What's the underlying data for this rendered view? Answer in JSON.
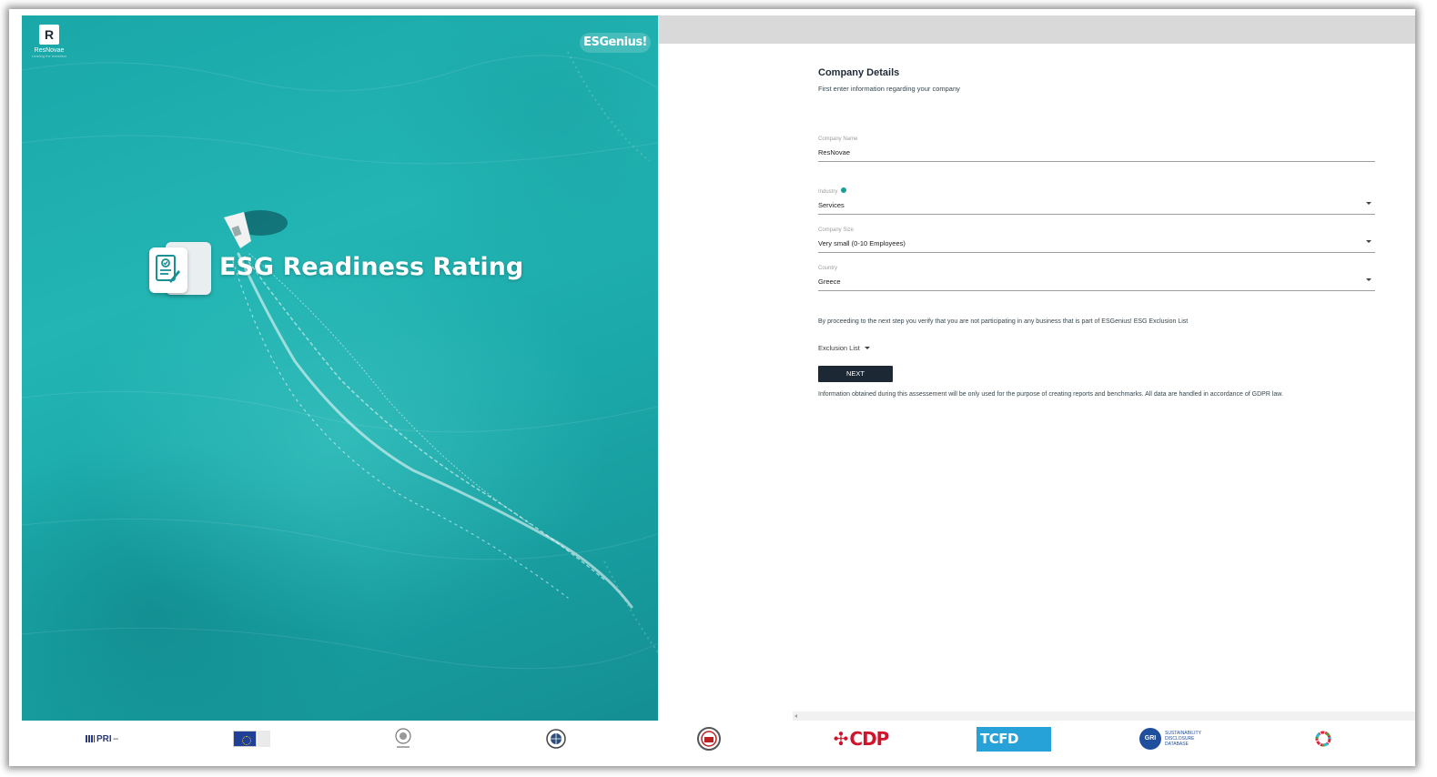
{
  "brand": {
    "left_logo_letter": "R",
    "left_logo_name": "ResNovae",
    "left_logo_tagline": "Leading the transition",
    "right_logo": "ESGenius!"
  },
  "hero": {
    "title": "ESG Readiness Rating"
  },
  "form": {
    "title": "Company Details",
    "subtitle": "First enter information regarding your company",
    "company_name": {
      "label": "Company Name",
      "value": "ResNovae"
    },
    "industry": {
      "label": "Industry",
      "value": "Services"
    },
    "company_size": {
      "label": "Company Size",
      "value": "Very small (0-10 Employees)"
    },
    "country": {
      "label": "Country",
      "value": "Greece"
    },
    "notice": "By proceeding to the next step you verify that you are not participating in any business that is part of ESGenius! ESG Exclusion List",
    "exclusion_list_label": "Exclusion List",
    "next_label": "NEXT",
    "gdpr_note": "Information obtained during this assessement will be only used for the purpose of creating reports and benchmarks. All data are handled in accordance of GDPR law."
  },
  "footer": {
    "logos": {
      "pri": "PRI",
      "cdp": "CDP",
      "tcfd": "TCFD",
      "gri": "GRI",
      "gri_text": "SUSTAINABILITY DISCLOSURE DATABASE"
    }
  },
  "colors": {
    "hero_teal": "#1aa7a8",
    "button_dark": "#1c2833",
    "info_teal": "#1a9e9a",
    "cdp_red": "#d0142c",
    "tcfd_blue": "#27a2d8",
    "gri_blue": "#1f4e9c"
  },
  "icons": {
    "hero": "document-check-icon",
    "dropdown": "caret-down-icon",
    "info": "info-icon"
  }
}
